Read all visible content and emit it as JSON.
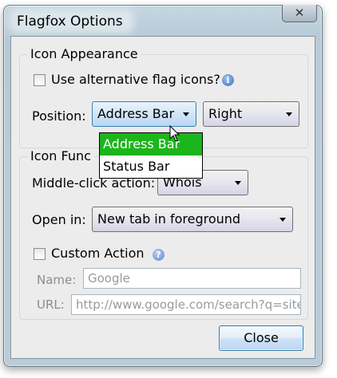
{
  "window": {
    "title": "Flagfox Options",
    "close_glyph": "✕"
  },
  "icon_appearance": {
    "group_title": "Icon Appearance",
    "alt_flags_label": "Use alternative flag icons?",
    "alt_flags_checked": false,
    "position_label": "Position:",
    "position_value": "Address Bar",
    "side_value": "Right",
    "position_options": [
      "Address Bar",
      "Status Bar"
    ],
    "selected_option": "Address Bar"
  },
  "icon_functions": {
    "group_title": "Icon Func",
    "middle_click_label": "Middle-click action:",
    "middle_click_value": "Whois",
    "open_in_label": "Open in:",
    "open_in_value": "New tab in foreground",
    "custom_action_label": "Custom Action",
    "custom_action_checked": false,
    "name_label": "Name:",
    "name_placeholder": "Google",
    "url_label": "URL:",
    "url_placeholder": "http://www.google.com/search?q=site"
  },
  "footer": {
    "close_label": "Close"
  },
  "icons": {
    "info": "info-icon",
    "help": "help-icon",
    "cursor": "mouse-pointer-icon"
  }
}
